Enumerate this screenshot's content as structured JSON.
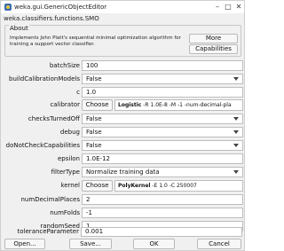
{
  "window": {
    "title": "weka.gui.GenericObjectEditor"
  },
  "class_name": "weka.classifiers.functions.SMO",
  "about": {
    "label": "About",
    "text": "Implements John Platt's sequential minimal optimization algorithm for training a support vector classifier.",
    "more_label": "More",
    "capabilities_label": "Capabilities"
  },
  "choose_label": "Choose",
  "params": {
    "batchSize": {
      "label": "batchSize",
      "value": "100"
    },
    "buildCalibrationModels": {
      "label": "buildCalibrationModels",
      "value": "False"
    },
    "c": {
      "label": "c",
      "value": "1.0"
    },
    "calibrator": {
      "label": "calibrator",
      "class": "Logistic",
      "args": " -R 1.0E-8 -M -1 -num-decimal-pla"
    },
    "checksTurnedOff": {
      "label": "checksTurnedOff",
      "value": "False"
    },
    "debug": {
      "label": "debug",
      "value": "False"
    },
    "doNotCheckCapabilities": {
      "label": "doNotCheckCapabilities",
      "value": "False"
    },
    "epsilon": {
      "label": "epsilon",
      "value": "1.0E-12"
    },
    "filterType": {
      "label": "filterType",
      "value": "Normalize training data"
    },
    "kernel": {
      "label": "kernel",
      "class": "PolyKernel",
      "args": " -E 1.0 -C 250007"
    },
    "numDecimalPlaces": {
      "label": "numDecimalPlaces",
      "value": "2"
    },
    "numFolds": {
      "label": "numFolds",
      "value": "-1"
    },
    "randomSeed": {
      "label": "randomSeed",
      "value": "1"
    },
    "toleranceParameter": {
      "label": "toleranceParameter",
      "value": "0.001"
    }
  },
  "buttons": {
    "open": "Open...",
    "save": "Save...",
    "ok": "OK",
    "cancel": "Cancel"
  }
}
